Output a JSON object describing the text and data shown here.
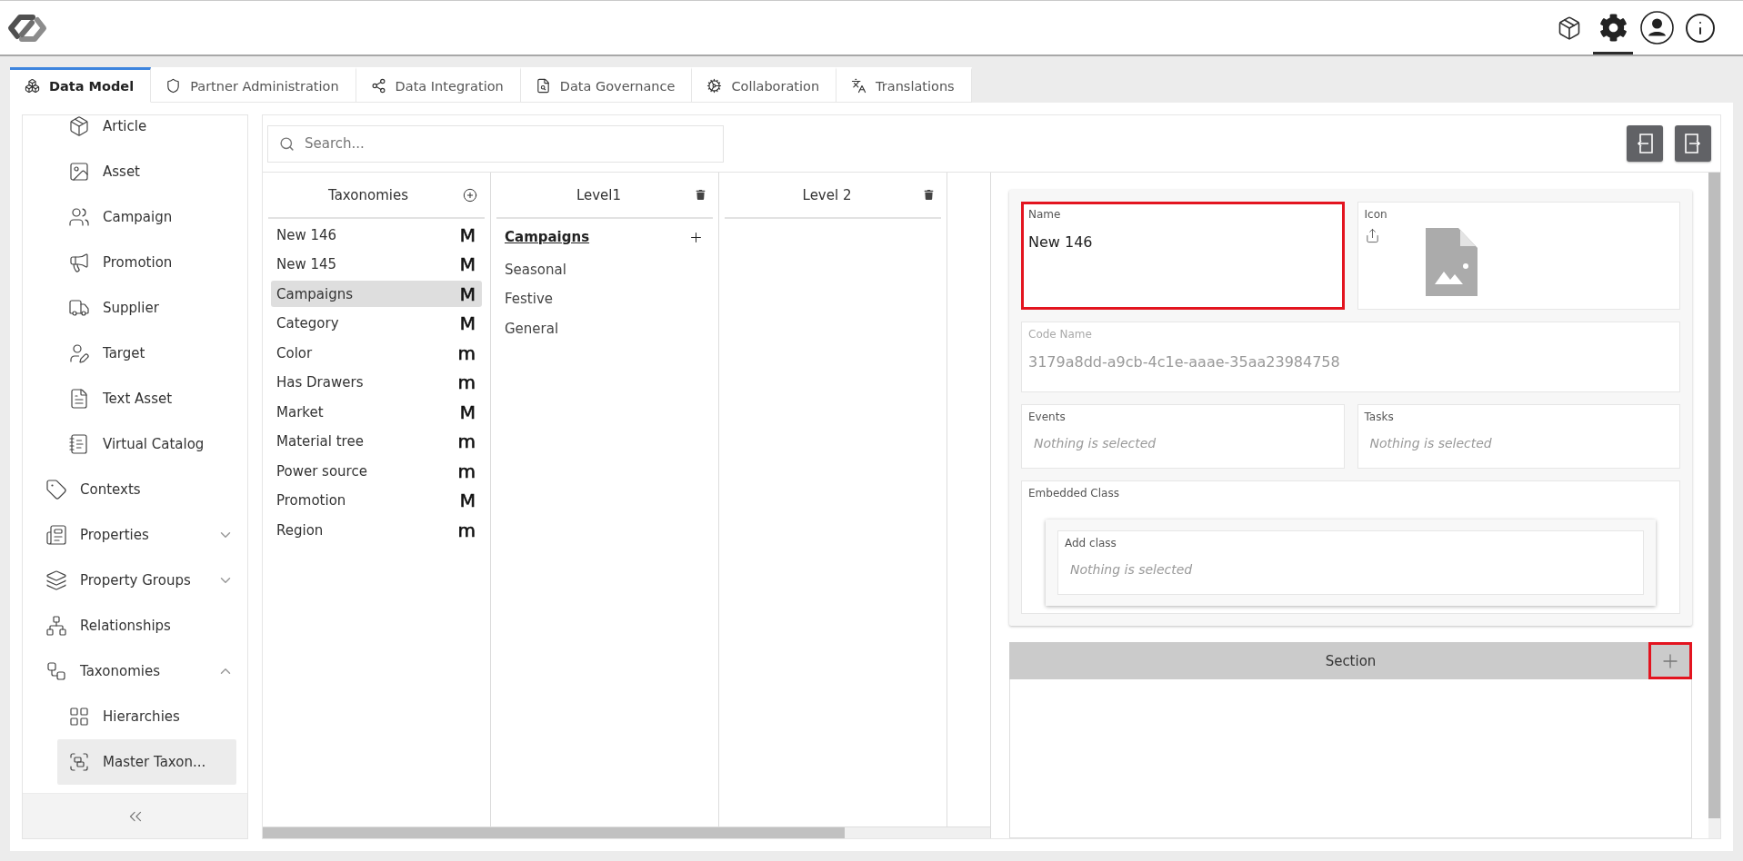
{
  "header": {
    "tools": [
      {
        "selected": false
      },
      {
        "selected": true
      },
      {
        "selected": false
      },
      {
        "selected": false
      }
    ]
  },
  "tabs": [
    {
      "label": "Data Model",
      "selected": true
    },
    {
      "label": "Partner Administration",
      "selected": false
    },
    {
      "label": "Data Integration",
      "selected": false
    },
    {
      "label": "Data Governance",
      "selected": false
    },
    {
      "label": "Collaboration",
      "selected": false
    },
    {
      "label": "Translations",
      "selected": false
    }
  ],
  "sidebar": {
    "items": [
      {
        "children": [
          {
            "label": "Article",
            "selected": false
          },
          {
            "label": "Asset",
            "selected": false
          },
          {
            "label": "Campaign",
            "selected": false
          },
          {
            "label": "Promotion",
            "selected": false
          },
          {
            "label": "Supplier",
            "selected": false
          },
          {
            "label": "Target",
            "selected": false
          },
          {
            "label": "Text Asset",
            "selected": false
          },
          {
            "label": "Virtual Catalog",
            "selected": false
          }
        ]
      },
      {
        "label": "Contexts",
        "selected": false
      },
      {
        "label": "Properties",
        "selected": false,
        "expanded": false
      },
      {
        "label": "Property Groups",
        "selected": false,
        "expanded": false
      },
      {
        "label": "Relationships",
        "selected": false
      },
      {
        "label": "Taxonomies",
        "selected": false,
        "expanded": true,
        "children": [
          {
            "label": "Hierarchies",
            "selected": false
          },
          {
            "label": "Master Taxon...",
            "selected": true
          }
        ]
      }
    ]
  },
  "search": {
    "placeholder": "Search..."
  },
  "taxonomies": {
    "title": "Taxonomies",
    "items": [
      {
        "label": "New 146",
        "marker": "M",
        "selected": false
      },
      {
        "label": "New 145",
        "marker": "M",
        "selected": false
      },
      {
        "label": "Campaigns",
        "marker": "M",
        "selected": true
      },
      {
        "label": "Category",
        "marker": "M",
        "selected": false
      },
      {
        "label": "Color",
        "marker": "m",
        "selected": false
      },
      {
        "label": "Has Drawers",
        "marker": "m",
        "selected": false
      },
      {
        "label": "Market",
        "marker": "M",
        "selected": false
      },
      {
        "label": "Material tree",
        "marker": "m",
        "selected": false
      },
      {
        "label": "Power source",
        "marker": "m",
        "selected": false
      },
      {
        "label": "Promotion",
        "marker": "M",
        "selected": false
      },
      {
        "label": "Region",
        "marker": "m",
        "selected": false
      }
    ]
  },
  "levels": [
    {
      "title": "Level1",
      "parent": "Campaigns",
      "items": [
        "Seasonal",
        "Festive",
        "General"
      ]
    },
    {
      "title": "Level 2"
    }
  ],
  "form": {
    "name": {
      "label": "Name",
      "value": "New 146",
      "highlighted": true
    },
    "icon": {
      "label": "Icon"
    },
    "code_name": {
      "label": "Code Name",
      "value": "3179a8dd-a9cb-4c1e-aaae-35aa23984758",
      "disabled": true
    },
    "events": {
      "label": "Events",
      "placeholder": "Nothing is selected"
    },
    "tasks": {
      "label": "Tasks",
      "placeholder": "Nothing is selected"
    },
    "embedded_class": {
      "label": "Embedded Class",
      "add_class": {
        "label": "Add class",
        "placeholder": "Nothing is selected"
      }
    }
  },
  "section": {
    "title": "Section",
    "add_highlighted": true
  }
}
